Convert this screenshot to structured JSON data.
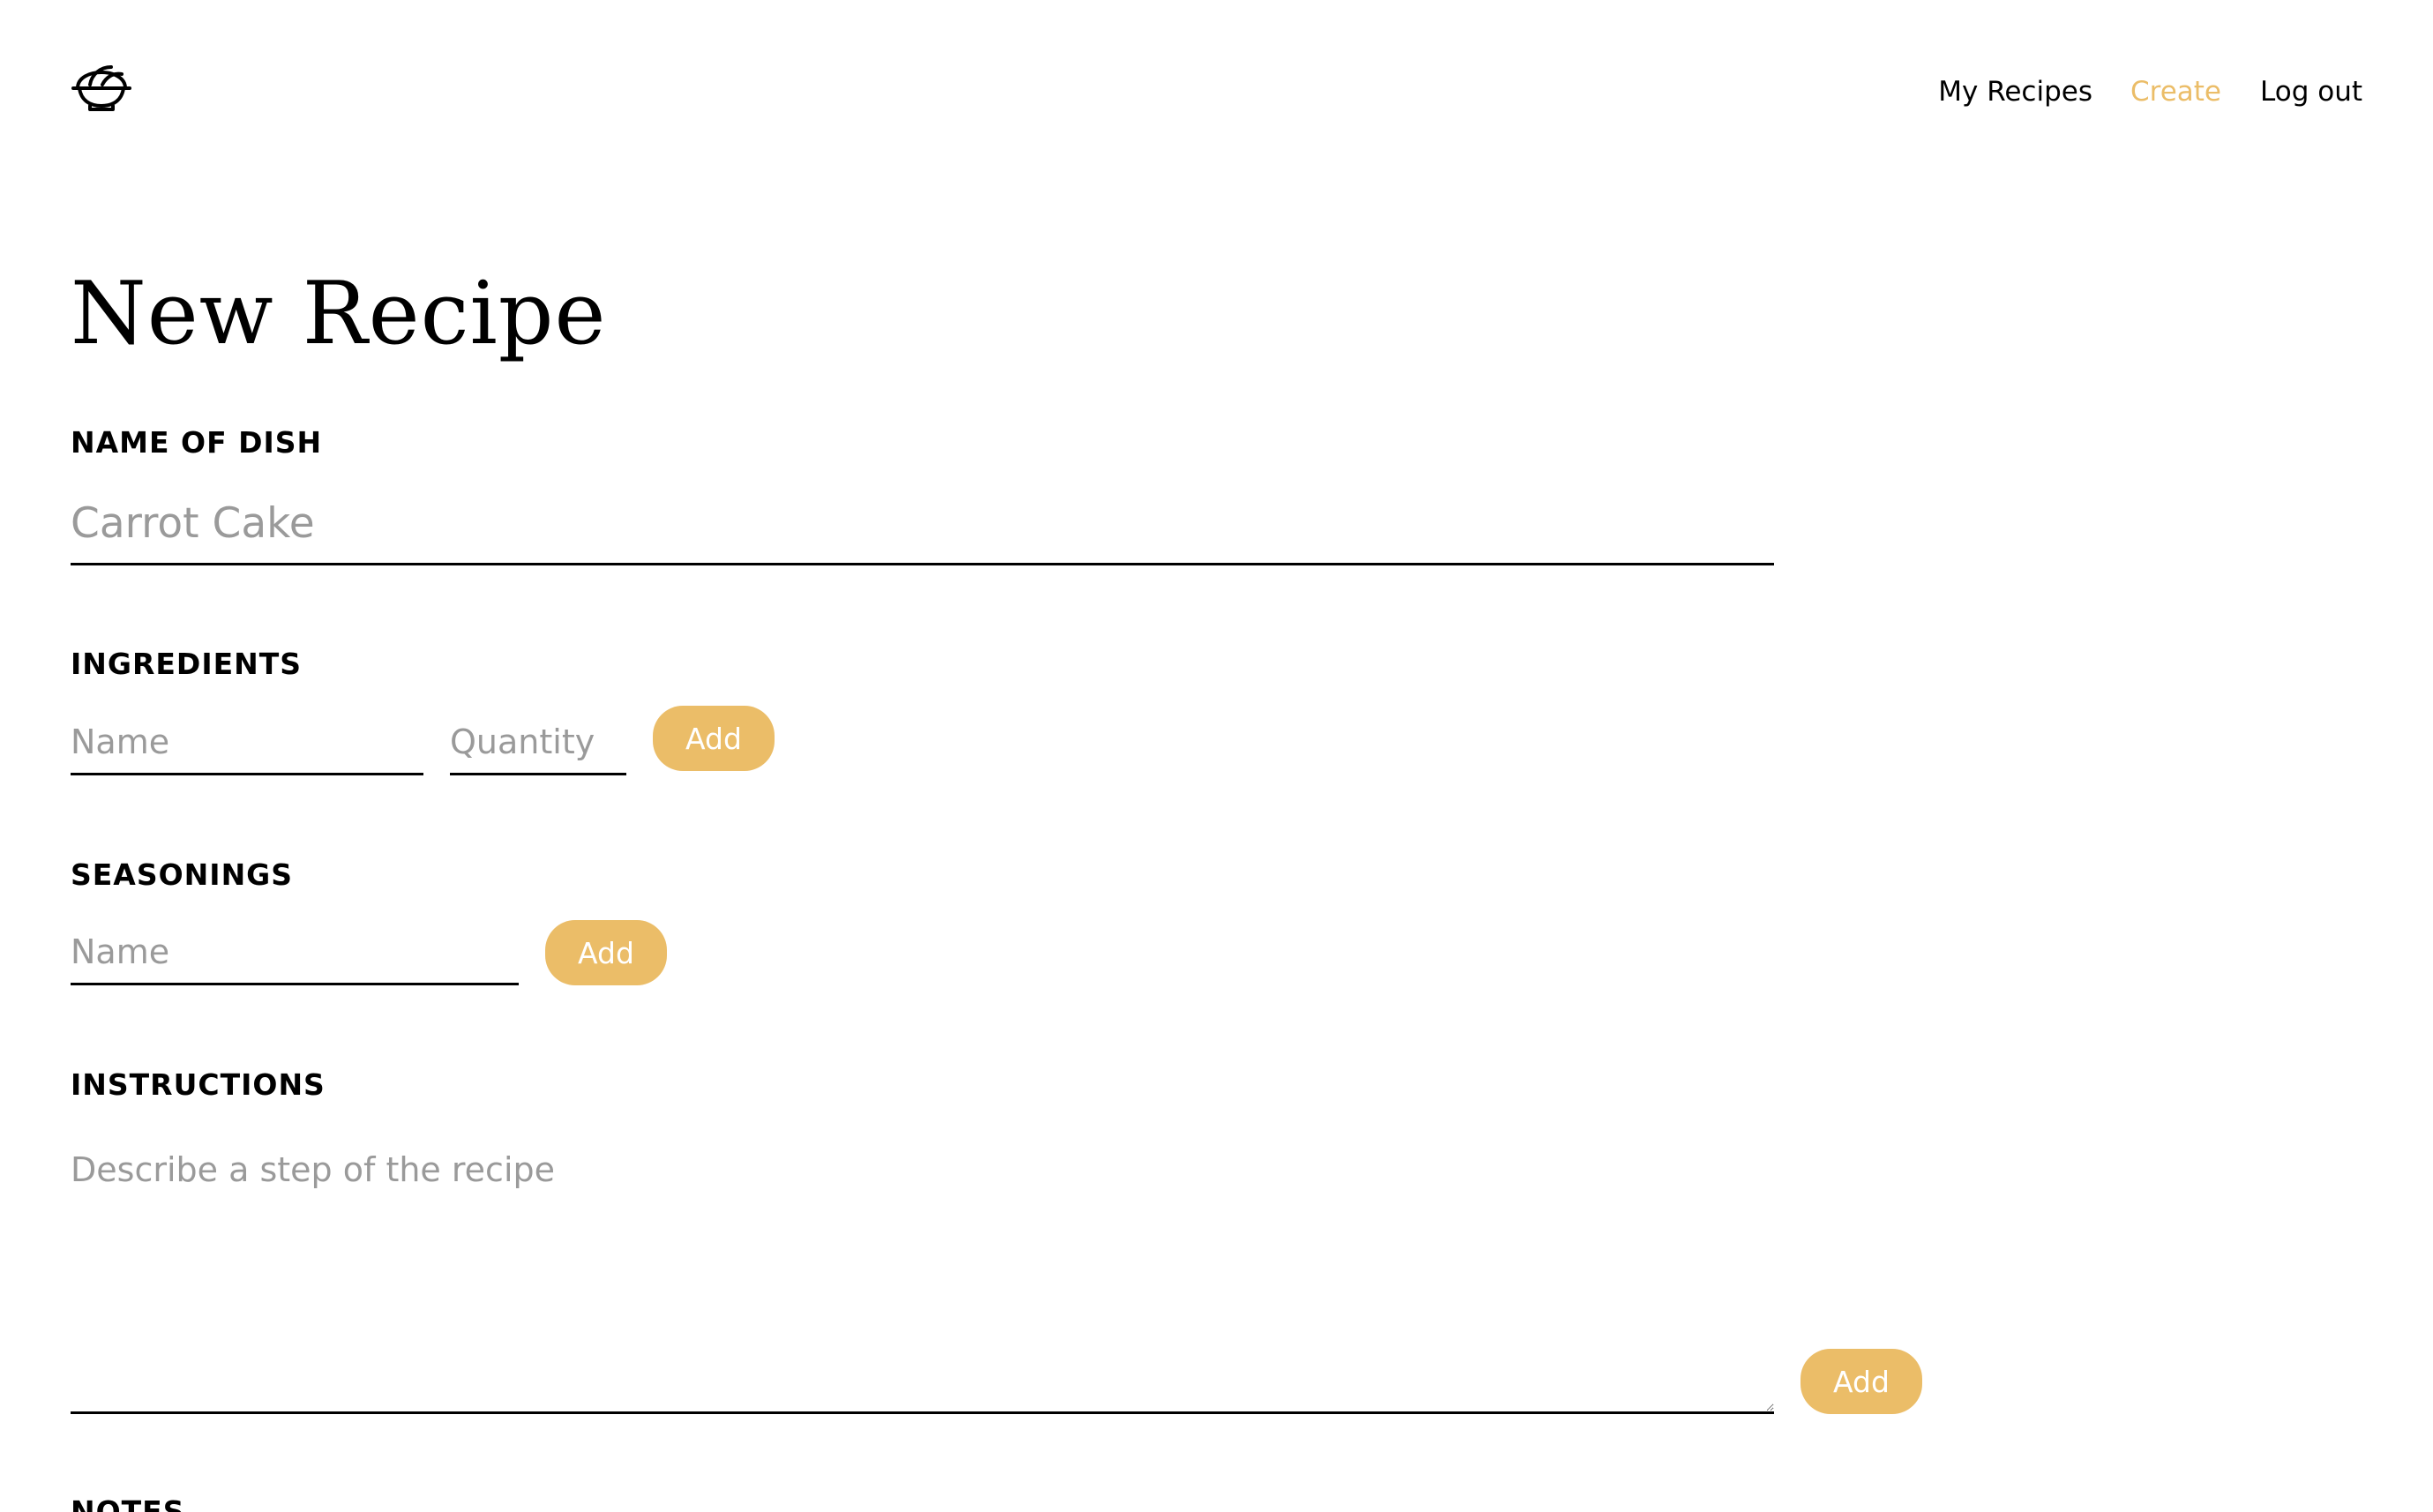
{
  "header": {
    "logo_icon": "bowl-icon",
    "nav": {
      "my_recipes": "My Recipes",
      "create": "Create",
      "logout": "Log out"
    },
    "active_color": "#ebbd68"
  },
  "page": {
    "title": "New Recipe"
  },
  "dish": {
    "label": "NAME OF DISH",
    "placeholder": "Carrot Cake",
    "value": ""
  },
  "ingredients": {
    "label": "INGREDIENTS",
    "name_placeholder": "Name",
    "quantity_placeholder": "Quantity",
    "add_label": "Add"
  },
  "seasonings": {
    "label": "SEASONINGS",
    "name_placeholder": "Name",
    "add_label": "Add"
  },
  "instructions": {
    "label": "INSTRUCTIONS",
    "placeholder": "Describe a step of the recipe",
    "add_label": "Add"
  },
  "notes": {
    "label": "NOTES"
  },
  "colors": {
    "accent": "#ebbd68",
    "placeholder": "#9a9a9a"
  }
}
